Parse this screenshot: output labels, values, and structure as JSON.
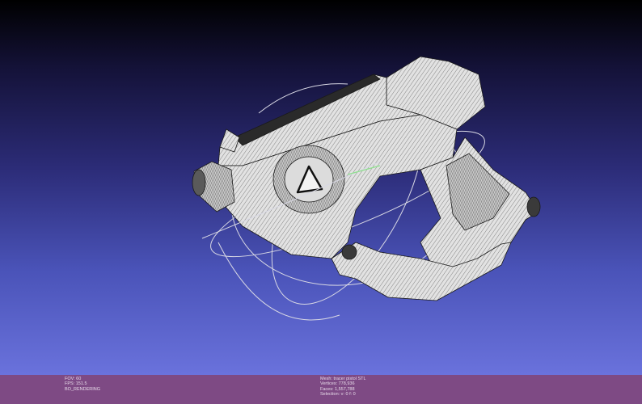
{
  "viewer": {
    "background_top": "#000000",
    "background_bottom": "#6a72dc",
    "model_color": "#e6e6e6",
    "wire_color": "#1a1a1a",
    "trackball_color": "#d8d8e4",
    "axis_highlight": "#8fe08f"
  },
  "status_bar": {
    "color": "#7e4a84",
    "left_info": [
      "FOV: 60",
      "FPS:   151.5",
      "BO_RENDERING"
    ],
    "right_info": [
      "Mesh: tracer pistol STL",
      "Vertices: 778,936",
      "Faces: 1,557,788",
      "Selection: v: 0 f: 0"
    ]
  }
}
